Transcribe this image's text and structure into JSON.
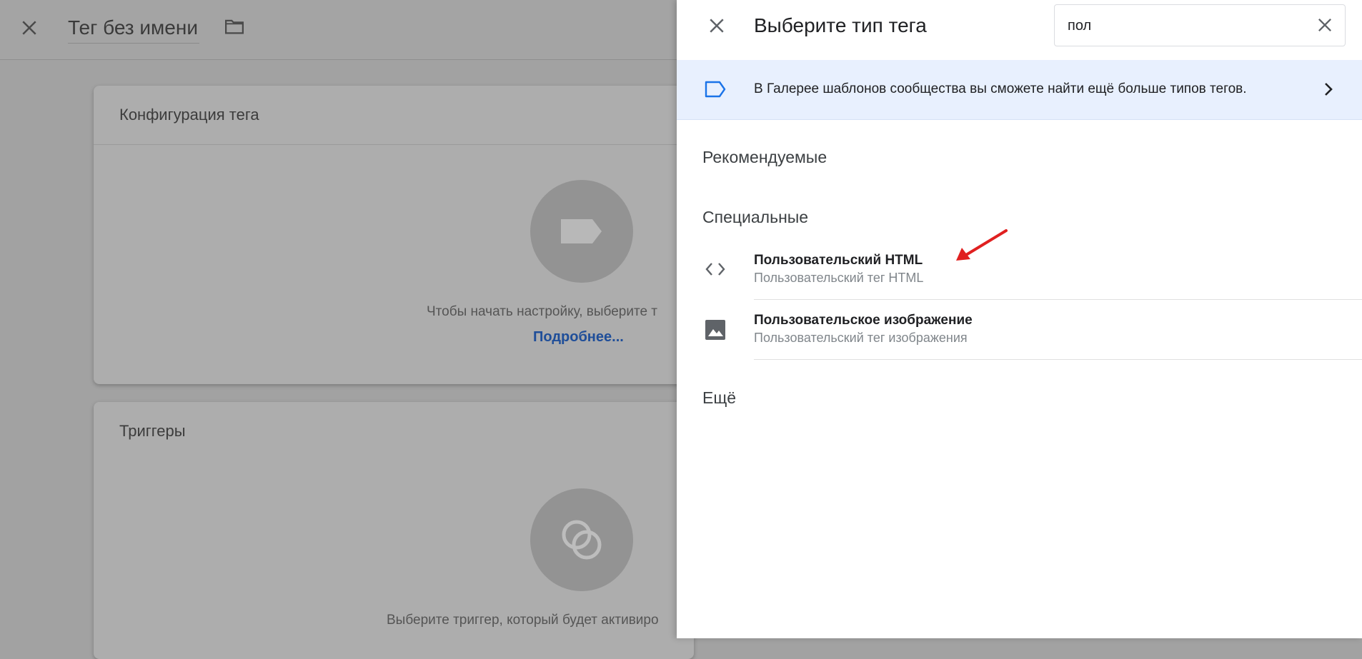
{
  "background": {
    "header": {
      "title": "Тег без имени"
    },
    "config_card": {
      "title": "Конфигурация тега",
      "hint": "Чтобы начать настройку, выберите т",
      "link": "Подробнее..."
    },
    "triggers_card": {
      "title": "Триггеры",
      "hint": "Выберите триггер, который будет активиро"
    }
  },
  "panel": {
    "title": "Выберите тип тега",
    "search": {
      "value": "пол"
    },
    "banner": {
      "text": "В Галерее шаблонов сообщества вы сможете найти ещё больше типов тегов."
    },
    "sections": {
      "recommended": "Рекомендуемые",
      "custom": "Специальные",
      "more": "Ещё"
    },
    "items": [
      {
        "title": "Пользовательский HTML",
        "subtitle": "Пользовательский тег HTML",
        "icon": "code-icon"
      },
      {
        "title": "Пользовательское изображение",
        "subtitle": "Пользовательский тег изображения",
        "icon": "image-icon"
      }
    ]
  },
  "colors": {
    "overlay": "#a2a2a2",
    "banner_bg": "#e8f0fe",
    "accent_blue": "#1a73e8",
    "annotation_arrow": "#e02020"
  }
}
